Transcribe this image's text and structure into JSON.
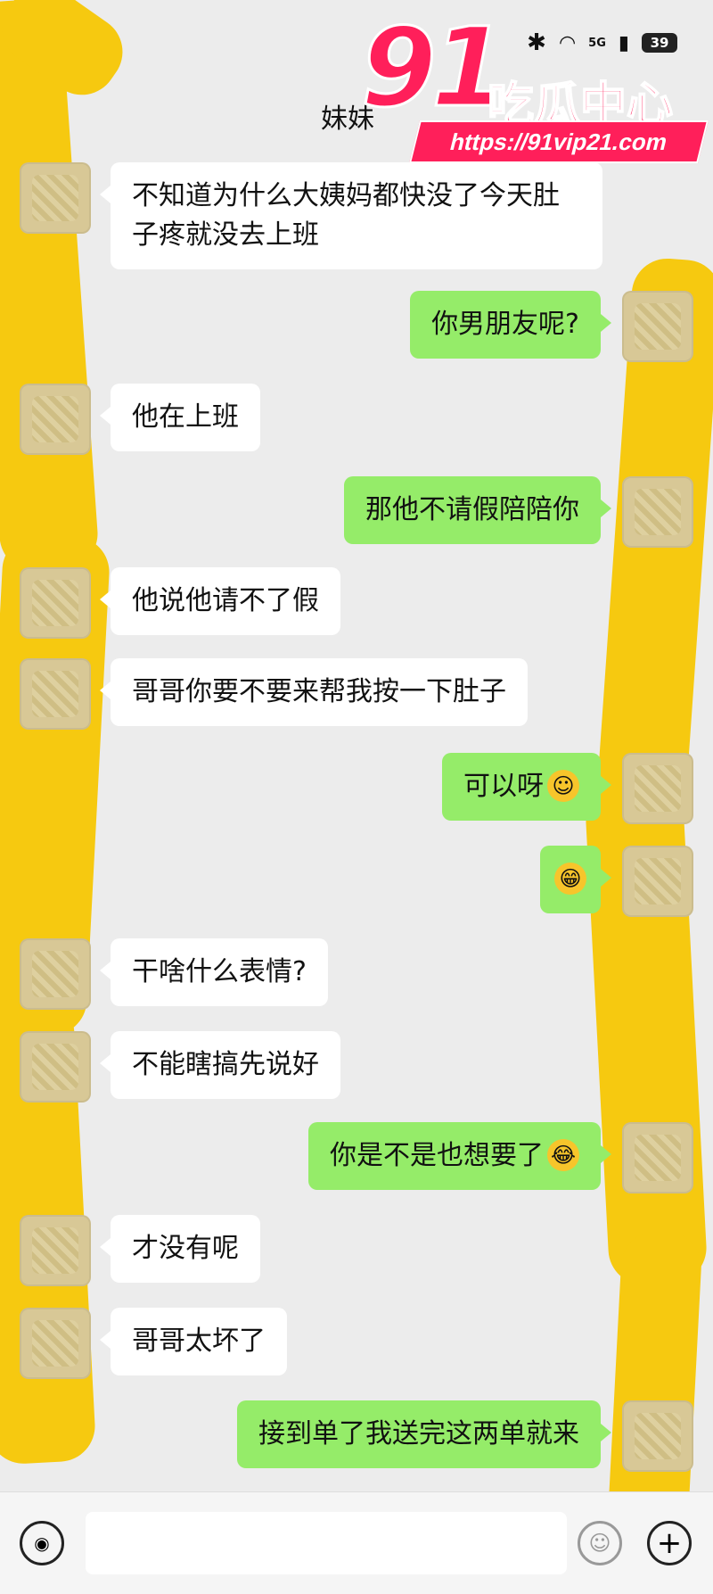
{
  "status_bar": {
    "network": "5G",
    "battery": "39"
  },
  "header": {
    "contact_name": "妹妹"
  },
  "watermark": {
    "number": "91",
    "name": "吃瓜中心",
    "url": "https://91vip21.com"
  },
  "messages": [
    {
      "side": "left",
      "text": "不知道为什么大姨妈都快没了今天肚子疼就没去上班"
    },
    {
      "side": "right",
      "text": "你男朋友呢?"
    },
    {
      "side": "left",
      "text": "他在上班"
    },
    {
      "side": "right",
      "text": "那他不请假陪陪你"
    },
    {
      "side": "left",
      "text": "他说他请不了假"
    },
    {
      "side": "left",
      "text": "哥哥你要不要来帮我按一下肚子"
    },
    {
      "side": "right",
      "text": "可以呀",
      "emoji": "☺"
    },
    {
      "side": "right",
      "text": "",
      "emoji": "😁"
    },
    {
      "side": "left",
      "text": "干啥什么表情?"
    },
    {
      "side": "left",
      "text": "不能瞎搞先说好"
    },
    {
      "side": "right",
      "text": "你是不是也想要了",
      "emoji": "😂"
    },
    {
      "side": "left",
      "text": "才没有呢"
    },
    {
      "side": "left",
      "text": "哥哥太坏了"
    },
    {
      "side": "right",
      "text": "接到单了我送完这两单就来"
    }
  ],
  "input_bar": {
    "voice_icon": "voice-icon",
    "emoji_icon": "emoji-icon",
    "plus_icon": "plus-icon"
  },
  "colors": {
    "self_bubble": "#95ec69",
    "other_bubble": "#ffffff",
    "background": "#ececec",
    "marker": "#f6c910",
    "watermark": "#ff1f5a"
  }
}
